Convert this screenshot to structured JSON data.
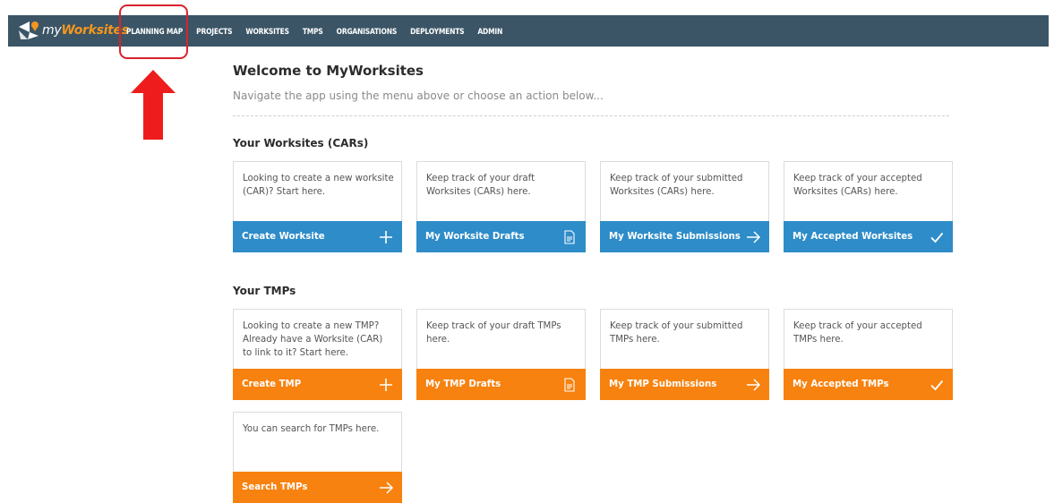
{
  "app": {
    "name_prefix": "my",
    "name_accent": "Worksites"
  },
  "nav": {
    "items": [
      {
        "id": "planning-map",
        "label": "PLANNING MAP"
      },
      {
        "id": "projects",
        "label": "PROJECTS"
      },
      {
        "id": "worksites",
        "label": "WORKSITES"
      },
      {
        "id": "tmps",
        "label": "TMPS"
      },
      {
        "id": "organisations",
        "label": "ORGANISATIONS"
      },
      {
        "id": "deployments",
        "label": "DEPLOYMENTS"
      },
      {
        "id": "admin",
        "label": "ADMIN"
      }
    ]
  },
  "annotation": {
    "color": "#d9232a",
    "target": "PLANNING MAP"
  },
  "welcome": {
    "title": "Welcome to MyWorksites",
    "subtitle": "Navigate the app using the menu above or choose an action below..."
  },
  "colors": {
    "topbar": "#3b5566",
    "blue": "#2e8cc8",
    "orange": "#f7820f",
    "logo_accent": "#f2961e"
  },
  "worksites": {
    "title": "Your Worksites (CARs)",
    "cards": [
      {
        "desc": "Looking to create a new worksite (CAR)? Start here.",
        "action": "Create Worksite",
        "icon": "plus-icon"
      },
      {
        "desc": "Keep track of your draft Worksites (CARs) here.",
        "action": "My Worksite Drafts",
        "icon": "document-icon"
      },
      {
        "desc": "Keep track of your submitted Worksites (CARs) here.",
        "action": "My Worksite Submissions",
        "icon": "arrow-right-icon"
      },
      {
        "desc": "Keep track of your accepted Worksites (CARs) here.",
        "action": "My Accepted Worksites",
        "icon": "check-icon"
      }
    ]
  },
  "tmps": {
    "title": "Your TMPs",
    "cards": [
      {
        "desc": "Looking to create a new TMP? Already have a Worksite (CAR) to link to it? Start here.",
        "action": "Create TMP",
        "icon": "plus-icon"
      },
      {
        "desc": "Keep track of your draft TMPs here.",
        "action": "My TMP Drafts",
        "icon": "document-icon"
      },
      {
        "desc": "Keep track of your submitted TMPs here.",
        "action": "My TMP Submissions",
        "icon": "arrow-right-icon"
      },
      {
        "desc": "Keep track of your accepted TMPs here.",
        "action": "My Accepted TMPs",
        "icon": "check-icon"
      },
      {
        "desc": "You can search for TMPs here.",
        "action": "Search TMPs",
        "icon": "arrow-right-icon"
      }
    ]
  }
}
